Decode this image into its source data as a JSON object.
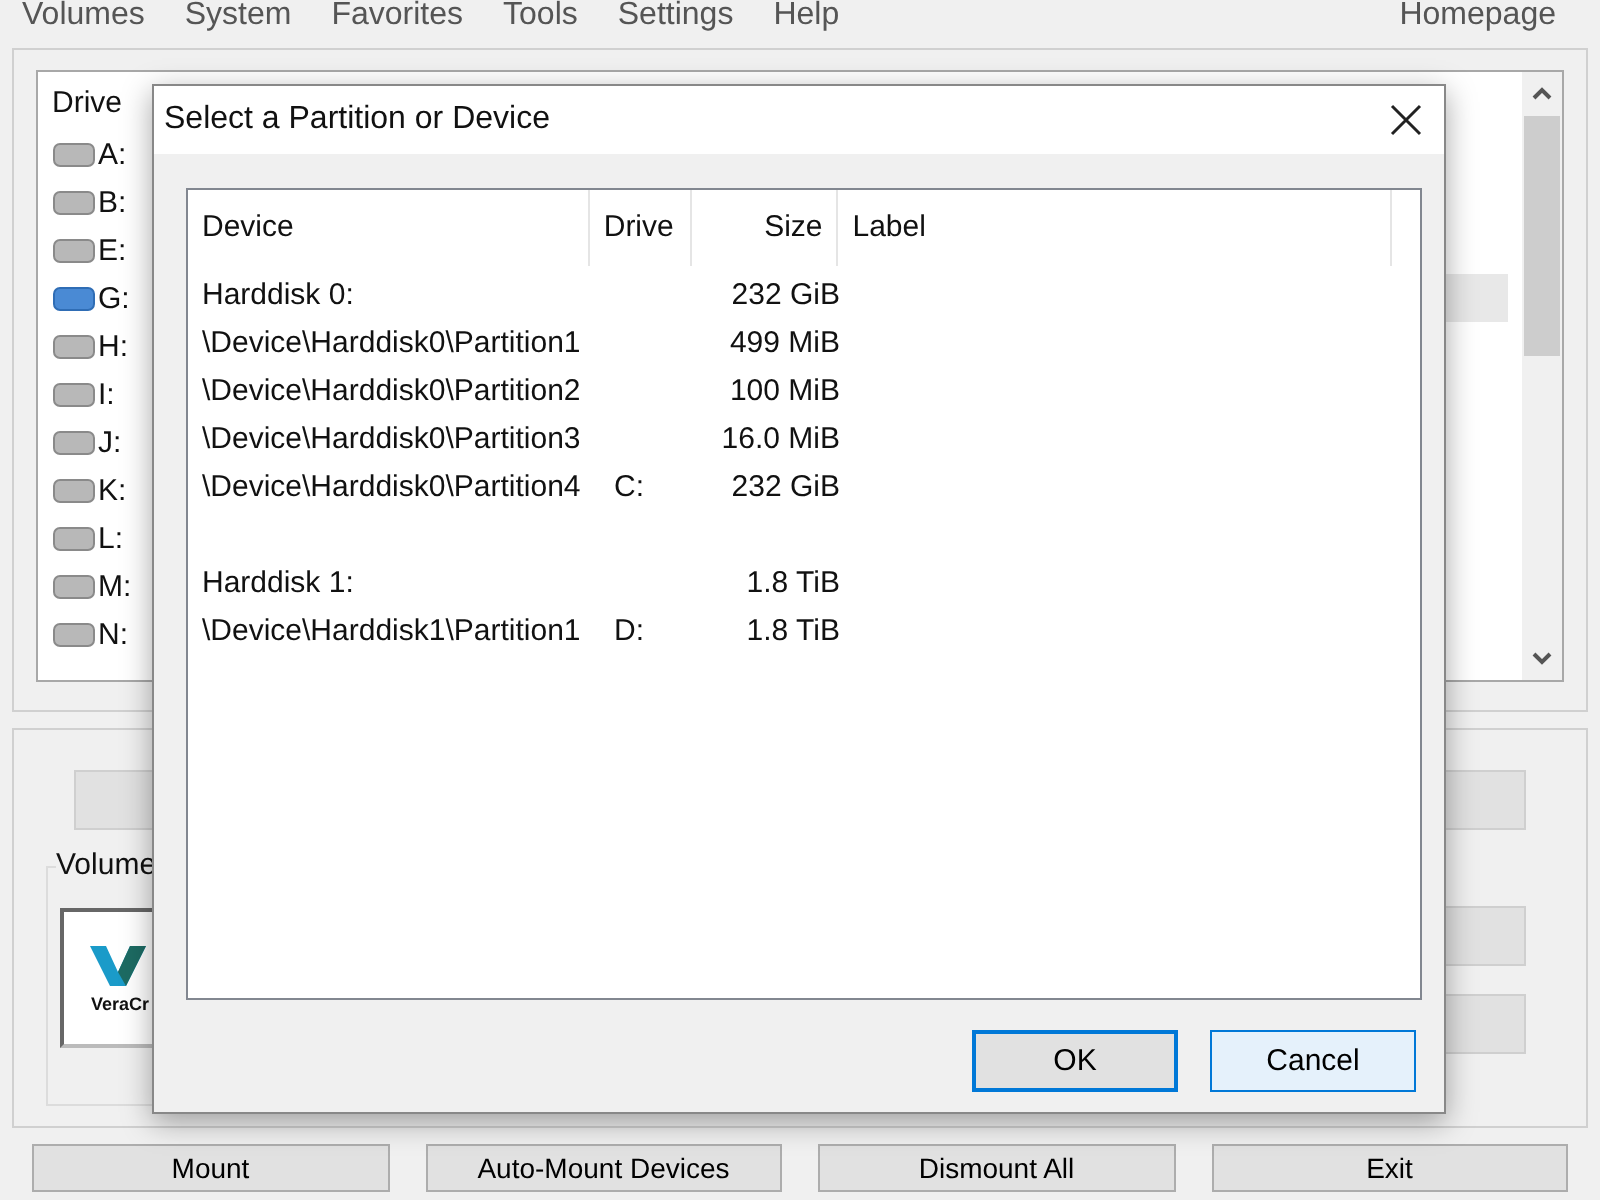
{
  "menu": [
    "Volumes",
    "System",
    "Favorites",
    "Tools",
    "Settings",
    "Help"
  ],
  "homepage": "Homepage",
  "drive_list": {
    "column": "Drive",
    "rows": [
      {
        "letter": "A:",
        "selected": false
      },
      {
        "letter": "B:",
        "selected": false
      },
      {
        "letter": "E:",
        "selected": false
      },
      {
        "letter": "G:",
        "selected": true
      },
      {
        "letter": "H:",
        "selected": false
      },
      {
        "letter": "I:",
        "selected": false
      },
      {
        "letter": "J:",
        "selected": false
      },
      {
        "letter": "K:",
        "selected": false
      },
      {
        "letter": "L:",
        "selected": false
      },
      {
        "letter": "M:",
        "selected": false
      },
      {
        "letter": "N:",
        "selected": false
      }
    ]
  },
  "volume_group": {
    "label": "Volume",
    "logo_text": "VeraCr"
  },
  "bottom_buttons": [
    "Mount",
    "Auto-Mount Devices",
    "Dismount All",
    "Exit"
  ],
  "dialog": {
    "title": "Select a Partition or Device",
    "columns": [
      "Device",
      "Drive",
      "Size",
      "Label"
    ],
    "disks": [
      {
        "device": "Harddisk 0:",
        "size": "232 GiB",
        "partitions": [
          {
            "device": "\\Device\\Harddisk0\\Partition1",
            "size": "499 MiB"
          },
          {
            "device": "\\Device\\Harddisk0\\Partition2",
            "size": "100 MiB"
          },
          {
            "device": "\\Device\\Harddisk0\\Partition3",
            "size": "16.0 MiB"
          },
          {
            "device": "\\Device\\Harddisk0\\Partition4",
            "drive": "C:",
            "size": "232 GiB"
          }
        ]
      },
      {
        "device": "Harddisk 1:",
        "size": "1.8 TiB",
        "partitions": [
          {
            "device": "\\Device\\Harddisk1\\Partition1",
            "drive": "D:",
            "size": "1.8 TiB"
          }
        ]
      }
    ],
    "buttons": [
      {
        "label": "OK",
        "default": true,
        "hot": false
      },
      {
        "label": "Cancel",
        "default": false,
        "hot": true
      }
    ]
  }
}
